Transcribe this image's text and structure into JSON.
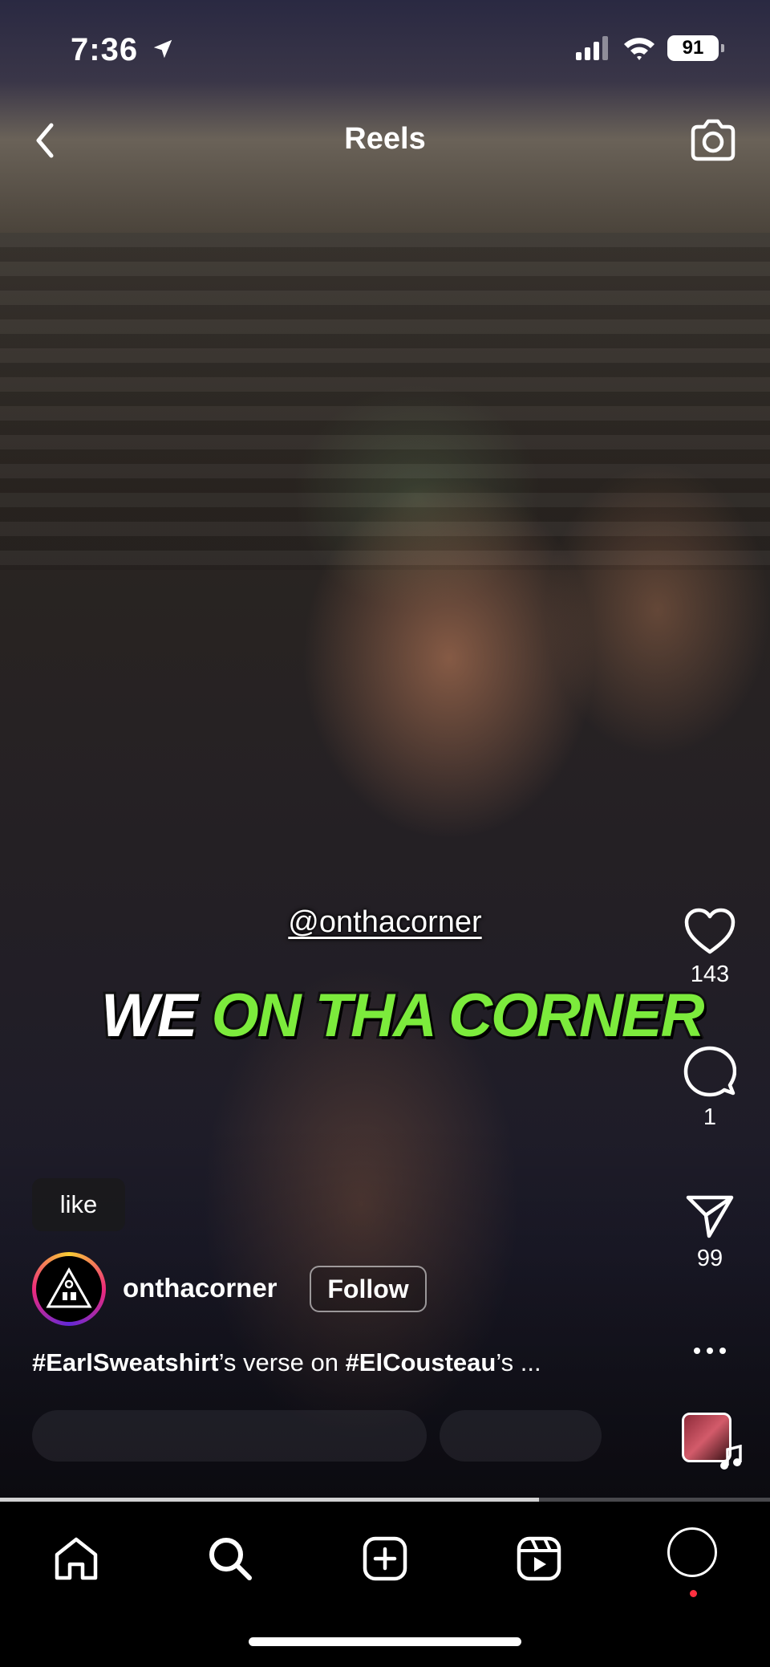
{
  "status_bar": {
    "time": "7:36",
    "battery": "91"
  },
  "header": {
    "title": "Reels"
  },
  "video_overlay": {
    "mention": "@onthacorner",
    "caption_word_1": "WE",
    "caption_word_2": "ON THA CORNER"
  },
  "actions": {
    "likes": "143",
    "comments": "1",
    "shares": "99"
  },
  "like_chip": "like",
  "post": {
    "username": "onthacorner",
    "follow_label": "Follow",
    "tag_1": "#EarlSweatshirt",
    "text_1": "’s verse on ",
    "tag_2": "#ElCousteau",
    "text_2": "’s ..."
  },
  "playback": {
    "progress": 0.7
  },
  "icons": [
    "location-arrow-icon",
    "signal-icon",
    "wifi-icon",
    "battery-icon",
    "back-chevron-icon",
    "camera-icon",
    "heart-icon",
    "comment-icon",
    "share-icon",
    "more-icon",
    "music-note-icon",
    "home-icon",
    "search-icon",
    "create-icon",
    "reels-icon",
    "profile-icon"
  ],
  "colors": {
    "caption_green": "#7CEB3C",
    "notification": "#ff3040"
  }
}
